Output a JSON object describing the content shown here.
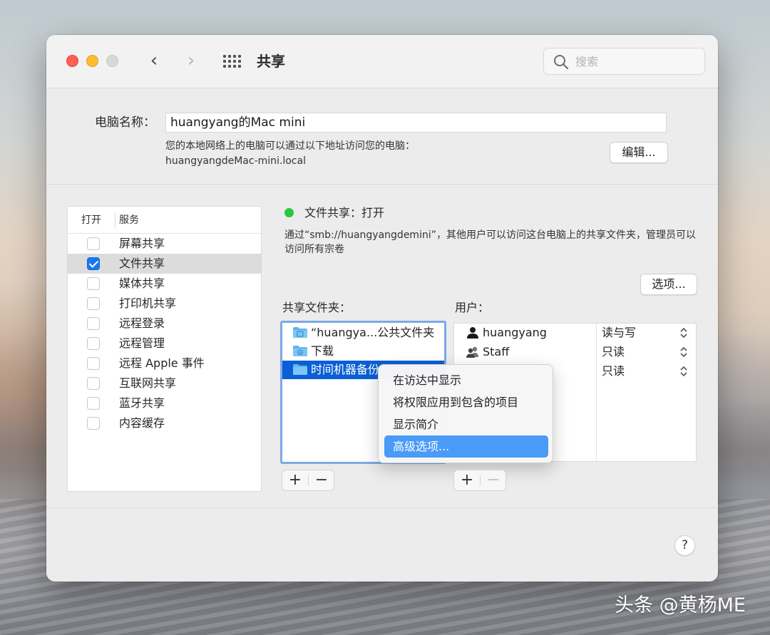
{
  "window": {
    "title": "共享",
    "search_placeholder": "搜索"
  },
  "computer": {
    "name_label": "电脑名称：",
    "name_value": "huangyang的Mac mini",
    "access_description": "您的本地网络上的电脑可以通过以下地址访问您的电脑：",
    "local_address": "huangyangdeMac-mini.local",
    "edit_button": "编辑..."
  },
  "services": {
    "header_on": "打开",
    "header_service": "服务",
    "items": [
      {
        "label": "屏幕共享",
        "checked": false,
        "selected": false
      },
      {
        "label": "文件共享",
        "checked": true,
        "selected": true
      },
      {
        "label": "媒体共享",
        "checked": false,
        "selected": false
      },
      {
        "label": "打印机共享",
        "checked": false,
        "selected": false
      },
      {
        "label": "远程登录",
        "checked": false,
        "selected": false
      },
      {
        "label": "远程管理",
        "checked": false,
        "selected": false
      },
      {
        "label": "远程 Apple 事件",
        "checked": false,
        "selected": false
      },
      {
        "label": "互联网共享",
        "checked": false,
        "selected": false
      },
      {
        "label": "蓝牙共享",
        "checked": false,
        "selected": false
      },
      {
        "label": "内容缓存",
        "checked": false,
        "selected": false
      }
    ]
  },
  "detail": {
    "status_text": "文件共享：打开",
    "status_color": "#28c840",
    "description": "通过“smb://huangyangdemini”，其他用户可以访问这台电脑上的共享文件夹，管理员可以访问所有宗卷",
    "options_button": "选项...",
    "folders_label": "共享文件夹：",
    "users_label": "用户：",
    "folders": [
      {
        "label": "“huangya...公共文件夹",
        "icon": "public-folder-icon",
        "selected": false
      },
      {
        "label": "下载",
        "icon": "downloads-folder-icon",
        "selected": false
      },
      {
        "label": "时间机器备份",
        "icon": "folder-icon",
        "selected": true
      }
    ],
    "users": [
      {
        "name": "huangyang",
        "icon": "user-icon",
        "permission": "读与写"
      },
      {
        "name": "Staff",
        "icon": "group-icon",
        "permission": "只读"
      },
      {
        "name": "",
        "icon": "",
        "permission": "只读"
      }
    ],
    "add_symbol": "+",
    "remove_symbol": "−"
  },
  "context_menu": {
    "items": [
      {
        "label": "在访达中显示",
        "highlighted": false
      },
      {
        "label": "将权限应用到包含的项目",
        "highlighted": false
      },
      {
        "label": "显示简介",
        "highlighted": false
      },
      {
        "label": "高级选项...",
        "highlighted": true
      }
    ]
  },
  "help_button": "?",
  "watermark": "头条 @黄杨ME",
  "colors": {
    "accent": "#0a5fd6",
    "menu_highlight": "#4a9af7",
    "close": "#ff5f57",
    "minimize": "#febc2e"
  }
}
